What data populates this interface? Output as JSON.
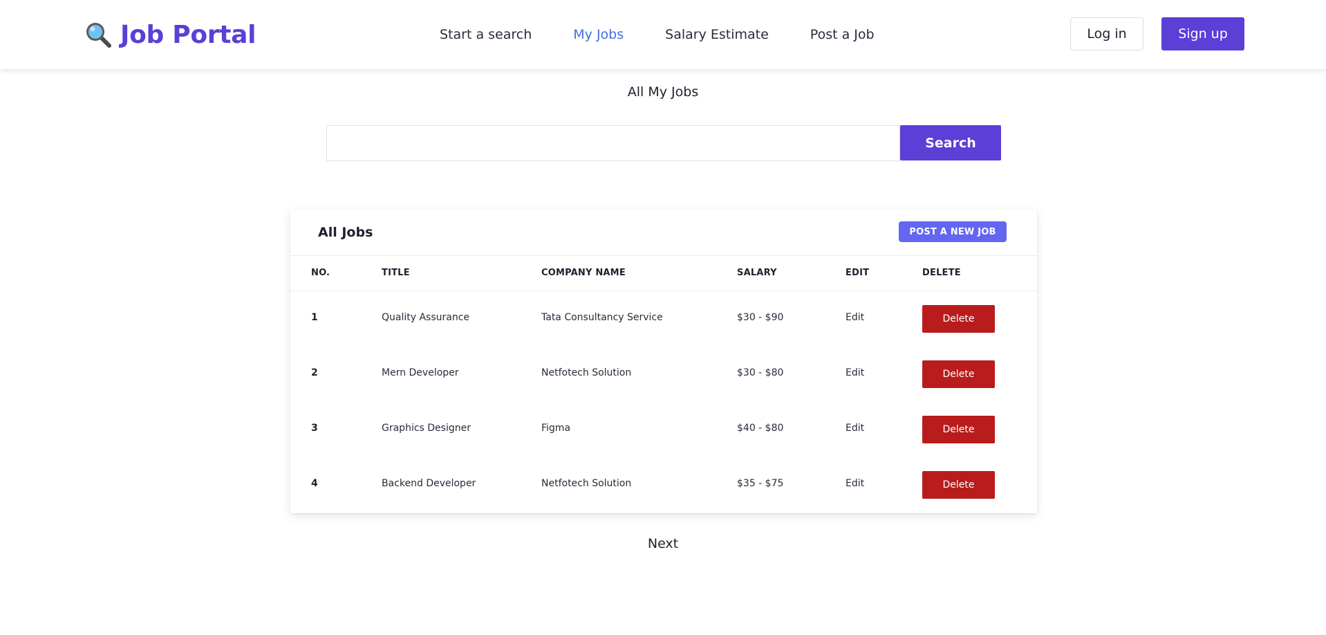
{
  "header": {
    "brand": "Job Portal",
    "brand_icon": "magnifier-icon",
    "nav": [
      {
        "label": "Start a search",
        "active": false
      },
      {
        "label": "My Jobs",
        "active": true
      },
      {
        "label": "Salary Estimate",
        "active": false
      },
      {
        "label": "Post a Job",
        "active": false
      }
    ],
    "login_label": "Log in",
    "signup_label": "Sign up"
  },
  "main": {
    "title": "All My Jobs",
    "search": {
      "value": "",
      "placeholder": "",
      "button_label": "Search"
    }
  },
  "jobs_card": {
    "title": "All Jobs",
    "post_button_label": "POST A NEW JOB",
    "columns": [
      "NO.",
      "TITLE",
      "COMPANY NAME",
      "SALARY",
      "EDIT",
      "DELETE"
    ],
    "rows": [
      {
        "no": "1",
        "title": "Quality Assurance",
        "company": "Tata Consultancy Service",
        "salary": "$30 - $90",
        "edit": "Edit",
        "delete": "Delete"
      },
      {
        "no": "2",
        "title": "Mern Developer",
        "company": "Netfotech Solution",
        "salary": "$30 - $80",
        "edit": "Edit",
        "delete": "Delete"
      },
      {
        "no": "3",
        "title": "Graphics Designer",
        "company": "Figma",
        "salary": "$40 - $80",
        "edit": "Edit",
        "delete": "Delete"
      },
      {
        "no": "4",
        "title": "Backend Developer",
        "company": "Netfotech Solution",
        "salary": "$35 - $75",
        "edit": "Edit",
        "delete": "Delete"
      }
    ]
  },
  "pagination": {
    "next_label": "Next"
  },
  "colors": {
    "brand": "#5b3fd6",
    "nav_active": "#3f6fe0",
    "post_button": "#6366f1",
    "delete_button": "#b91c1c"
  }
}
